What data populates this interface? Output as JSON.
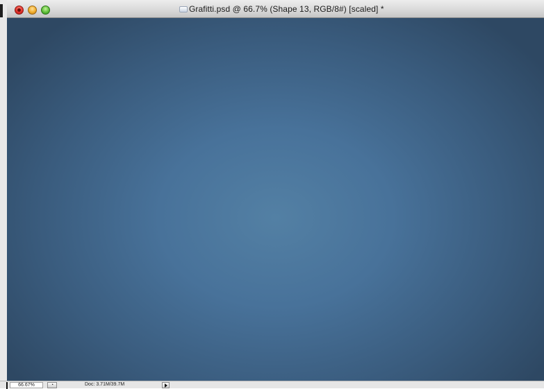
{
  "window": {
    "title": "Grafitti.psd @ 66.7% (Shape 13, RGB/8#) [scaled] *",
    "traffic_lights": {
      "close_icon": "close-icon",
      "minimize_icon": "minimize-icon",
      "zoom_icon": "zoom-icon"
    },
    "document_icon": "document-icon"
  },
  "canvas": {
    "gradient_center_color": "#5380a4",
    "gradient_edge_color": "#2e4863"
  },
  "statusbar": {
    "zoom_value": "66.67%",
    "status_button_glyph": "◔",
    "doc_info": "Doc: 3.71M/39.7M",
    "menu_arrow_icon": "play-arrow-icon"
  }
}
